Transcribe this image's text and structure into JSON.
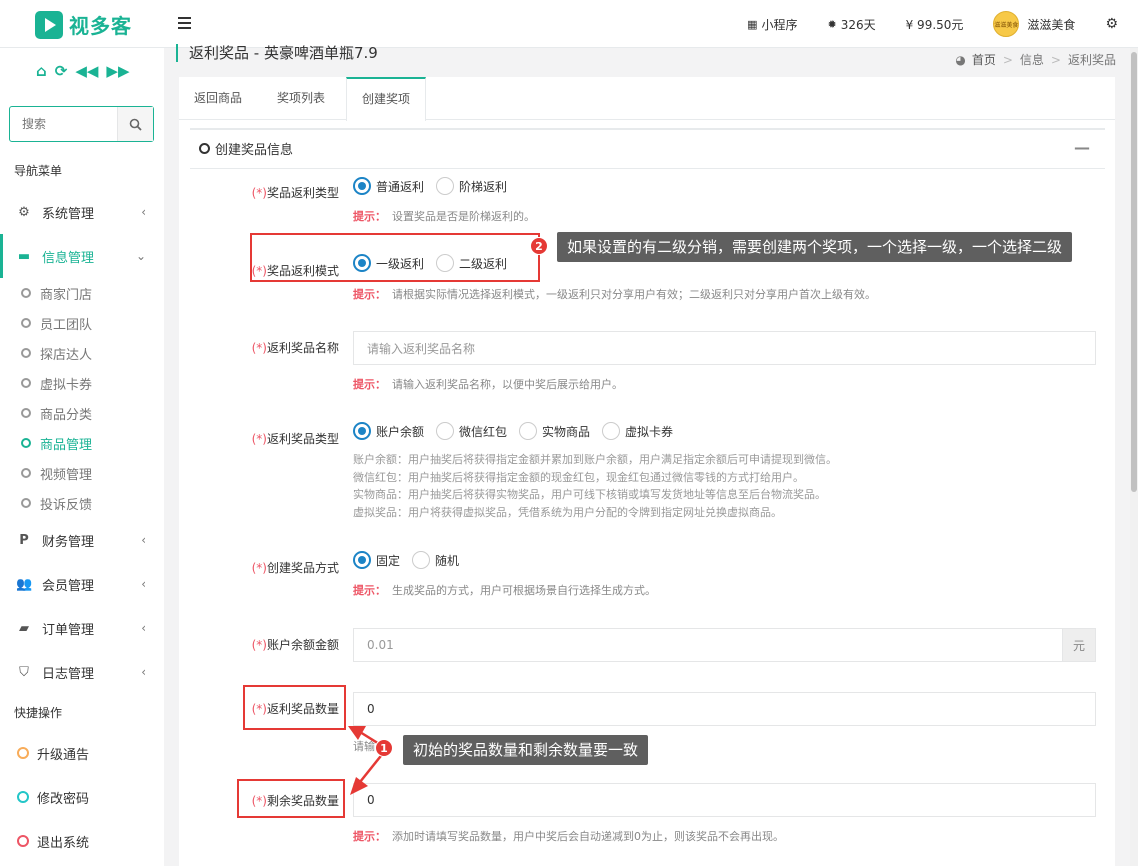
{
  "header": {
    "brand": "视多客",
    "mini_program": "小程序",
    "days": "326天",
    "balance": "¥ 99.50元",
    "store_name": "滋滋美食",
    "avatar_text": "滋滋美食"
  },
  "sidebar": {
    "search_placeholder": "搜索",
    "nav_header": "导航菜单",
    "items": [
      {
        "label": "系统管理",
        "icon": "gear-icon"
      },
      {
        "label": "信息管理",
        "icon": "briefcase-icon"
      },
      {
        "label": "财务管理",
        "icon": "paypal-icon"
      },
      {
        "label": "会员管理",
        "icon": "users-icon"
      },
      {
        "label": "订单管理",
        "icon": "truck-icon"
      },
      {
        "label": "日志管理",
        "icon": "shield-icon"
      }
    ],
    "sub_items": [
      "商家门店",
      "员工团队",
      "探店达人",
      "虚拟卡券",
      "商品分类",
      "商品管理",
      "视频管理",
      "投诉反馈"
    ],
    "quick_header": "快捷操作",
    "quick_ops": [
      {
        "label": "升级通告",
        "color": "#f8ac59"
      },
      {
        "label": "修改密码",
        "color": "#23c6c8"
      },
      {
        "label": "退出系统",
        "color": "#ed5565"
      }
    ]
  },
  "page": {
    "title": "返利奖品 - 英豪啤酒单瓶7.9",
    "breadcrumb": [
      "首页",
      "信息",
      "返利奖品"
    ]
  },
  "tabs": [
    "返回商品",
    "奖项列表",
    "创建奖项"
  ],
  "form": {
    "section_title": "创建奖品信息",
    "required_mark": "(*)",
    "hint_prefix": "提示：",
    "rebate_type": {
      "label": "奖品返利类型",
      "options": [
        "普通返利",
        "阶梯返利"
      ],
      "selected": "普通返利",
      "hint": "设置奖品是否是阶梯返利的。"
    },
    "rebate_mode": {
      "label": "奖品返利模式",
      "options": [
        "一级返利",
        "二级返利"
      ],
      "selected": "一级返利",
      "hint": "请根据实际情况选择返利模式，一级返利只对分享用户有效；二级返利只对分享用户首次上级有效。"
    },
    "prize_name": {
      "label": "返利奖品名称",
      "placeholder": "请输入返利奖品名称",
      "hint": "请输入返利奖品名称，以便中奖后展示给用户。"
    },
    "prize_type": {
      "label": "返利奖品类型",
      "options": [
        "账户余额",
        "微信红包",
        "实物商品",
        "虚拟卡券"
      ],
      "selected": "账户余额",
      "desc": [
        "账户余额：用户抽奖后将获得指定金额并累加到账户余额，用户满足指定余额后可申请提现到微信。",
        "微信红包：用户抽奖后将获得指定金额的现金红包，现金红包通过微信零钱的方式打给用户。",
        "实物商品：用户抽奖后将获得实物奖品，用户可线下核销或填写发货地址等信息至后台物流奖品。",
        "虚拟奖品：用户将获得虚拟奖品，凭借系统为用户分配的令牌到指定网址兑换虚拟商品。"
      ]
    },
    "create_method": {
      "label": "创建奖品方式",
      "options": [
        "固定",
        "随机"
      ],
      "selected": "固定",
      "hint": "生成奖品的方式，用户可根据场景自行选择生成方式。"
    },
    "balance_amount": {
      "label": "账户余额金额",
      "placeholder": "0.01",
      "unit": "元"
    },
    "prize_quantity": {
      "label": "返利奖品数量",
      "value": "0",
      "hint_partial": "请输"
    },
    "remaining_quantity": {
      "label": "剩余奖品数量",
      "value": "0",
      "hint": "添加时请填写奖品数量，用户中奖后会自动递减到0为止，则该奖品不会再出现。"
    }
  },
  "annotations": {
    "callout_1_num": "1",
    "callout_1": "初始的奖品数量和剩余数量要一致",
    "callout_2_num": "2",
    "callout_2": "如果设置的有二级分销，需要创建两个奖项，一个选择一级，一个选择二级"
  },
  "colors": {
    "accent": "#1ab394",
    "radio": "#1c84c6",
    "required": "#ed5565",
    "annotation": "#e53935"
  }
}
